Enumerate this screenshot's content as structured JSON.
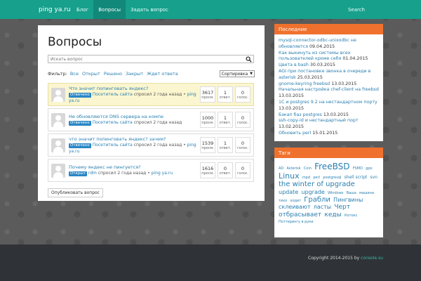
{
  "navbar": {
    "brand": "ping ya.ru",
    "items": [
      {
        "label": "Блог"
      },
      {
        "label": "Вопросы"
      },
      {
        "label": "Задать вопрос"
      }
    ],
    "search": "Search"
  },
  "main": {
    "title": "Вопросы",
    "search_placeholder": "Искать вопрос",
    "filter_label": "Фильтр:",
    "filters": [
      "Все",
      "Открыт",
      "Решено",
      "Закрыт",
      "Ждет ответа"
    ],
    "sort_label": "Сортировка",
    "questions": [
      {
        "title": "Что значит попинговать яндекс?",
        "status": "Отвечено",
        "author": "Посетитель сайта",
        "meta": "спросил 2 года назад •",
        "site": "ping ya.ru",
        "views": "3617",
        "views_label": "просм.",
        "answers": "1",
        "answers_label": "ответ.",
        "votes": "0",
        "votes_label": "голос."
      },
      {
        "title": "Не обновляются DNS сервера на компе",
        "status": "Отвечено",
        "author": "Посетитель сайта",
        "meta": "спросил 2 года назад",
        "site": "",
        "views": "1000",
        "views_label": "просм.",
        "answers": "1",
        "answers_label": "ответ.",
        "votes": "0",
        "votes_label": "голос."
      },
      {
        "title": "что значит попинговать яндекс? зачем?",
        "status": "Отвечено",
        "author": "Посетитель сайта",
        "meta": "спросил 2 года назад •",
        "site": "ping ya.ru",
        "views": "1539",
        "views_label": "просм.",
        "answers": "1",
        "answers_label": "ответ.",
        "votes": "0",
        "votes_label": "голос."
      },
      {
        "title": "Почему яндекс не пингуется?",
        "status": "Открыт",
        "author": "rdm",
        "meta": "спросил 2 года назад •",
        "site": "ping ya.ru",
        "views": "1616",
        "views_label": "просм.",
        "answers": "0",
        "answers_label": "ответ.",
        "votes": "0",
        "votes_label": "голос."
      }
    ],
    "publish_button": "Опубликовать вопрос"
  },
  "sidebar": {
    "recent_title": "Последние",
    "recent": [
      {
        "title": "mysql-connector-odbc-unixodbc не обновляется",
        "date": "09.04.2015"
      },
      {
        "title": "Как выкинуть из системы всех пользователей кроме себя",
        "date": "01.04.2015"
      },
      {
        "title": "Цвета в bash",
        "date": "30.03.2015"
      },
      {
        "title": "AGI при постановке звонка в очереди в asterisk",
        "date": "25.03.2015"
      },
      {
        "title": "gnome-keyring freebsd",
        "date": "13.03.2015"
      },
      {
        "title": "Начальная настройка chef-client на freebsd",
        "date": "13.03.2015"
      },
      {
        "title": "1C и postgres 9.2 на нестандартном порту",
        "date": "13.03.2015"
      },
      {
        "title": "Бэкап баз postgres",
        "date": "13.03.2015"
      },
      {
        "title": "ssh-copy-id и нестандартный порт",
        "date": "13.02.2015"
      },
      {
        "title": "Обновить perl",
        "date": "15.01.2015"
      }
    ],
    "tags_title": "Таги",
    "tags": [
      {
        "text": "AD",
        "size": 5
      },
      {
        "text": "Asterisk",
        "size": 5
      },
      {
        "text": "Coin",
        "size": 5
      },
      {
        "text": "FreeBSD",
        "size": 12
      },
      {
        "text": "FSMO",
        "size": 5
      },
      {
        "text": "gpo",
        "size": 5
      },
      {
        "text": "Linux",
        "size": 11
      },
      {
        "text": "mpd",
        "size": 5
      },
      {
        "text": "perl",
        "size": 5
      },
      {
        "text": "postgresql",
        "size": 5
      },
      {
        "text": "shell script",
        "size": 6
      },
      {
        "text": "svn",
        "size": 6
      },
      {
        "text": "the winter of upgrade",
        "size": 10
      },
      {
        "text": "update",
        "size": 8
      },
      {
        "text": "upgrade",
        "size": 8
      },
      {
        "text": "Windows",
        "size": 5
      },
      {
        "text": "Ваша",
        "size": 5
      },
      {
        "text": "машина",
        "size": 5
      },
      {
        "text": "тихо",
        "size": 5
      },
      {
        "text": "ходит",
        "size": 5
      },
      {
        "text": "Грабли",
        "size": 10
      },
      {
        "text": "Пингвины склеивают",
        "size": 8
      },
      {
        "text": "ласты",
        "size": 8
      },
      {
        "text": "Черт отбрасывает",
        "size": 9
      },
      {
        "text": "кеды",
        "size": 9
      },
      {
        "text": "Котокс",
        "size": 5
      },
      {
        "text": "Поттерингу в руки",
        "size": 5
      }
    ]
  },
  "footer": {
    "copyright_prefix": "Copyright 2014-2015 by",
    "copyright_link": "console.su"
  }
}
